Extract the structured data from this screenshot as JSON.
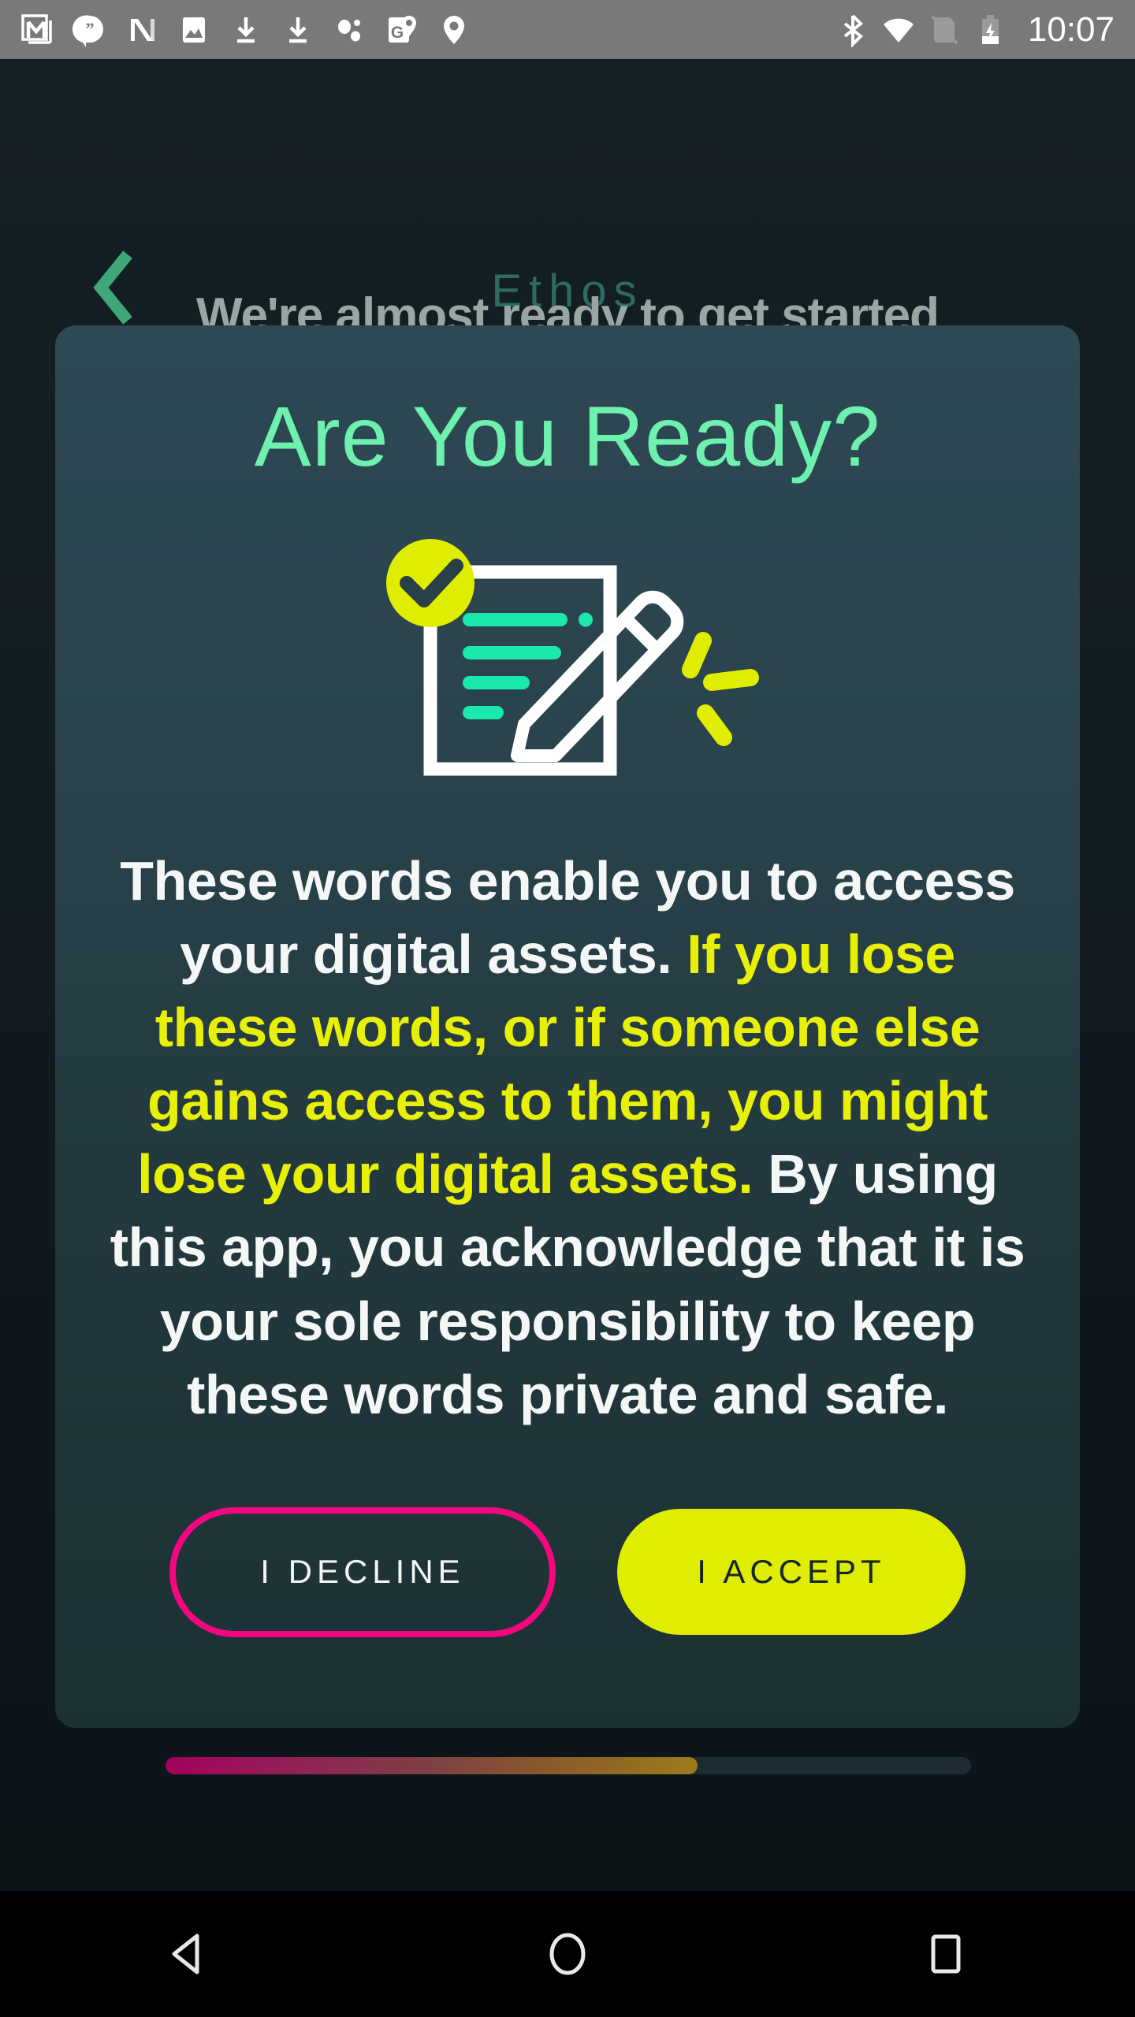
{
  "status_bar": {
    "time": "10:07",
    "left_icons": [
      {
        "name": "gmail-icon",
        "glyph": "M"
      },
      {
        "name": "hangouts-icon",
        "glyph": "❝"
      },
      {
        "name": "news-icon",
        "glyph": "N"
      },
      {
        "name": "photos-icon",
        "glyph": "⛰"
      },
      {
        "name": "download-icon-1",
        "glyph": "⬇"
      },
      {
        "name": "download-icon-2",
        "glyph": "⬇"
      },
      {
        "name": "nearby-share-icon",
        "glyph": "∵"
      },
      {
        "name": "google-maps-pin-icon",
        "glyph": "G"
      },
      {
        "name": "location-pin-icon",
        "glyph": "●"
      }
    ],
    "right_icons": [
      {
        "name": "bluetooth-icon",
        "glyph": "ᛗ"
      },
      {
        "name": "wifi-icon",
        "glyph": "▲"
      },
      {
        "name": "no-sim-icon",
        "glyph": "▭"
      },
      {
        "name": "battery-charging-icon",
        "glyph": "⚡"
      }
    ]
  },
  "top_nav": {
    "back_label": "‹",
    "title": "Ethos"
  },
  "background": {
    "obscured_heading": "We're almost ready to get started"
  },
  "modal": {
    "title": "Are You Ready?",
    "illustration": {
      "name": "signed-document-illustration",
      "check_badge_color": "#DFEE00",
      "check_color": "#2A4048",
      "document_color": "#FFFFFF",
      "line_color": "#1AE8AC",
      "sparkle_color": "#DFEE00",
      "document_lines": 4
    },
    "body": {
      "part1": "These words enable you to access your digital assets. ",
      "highlight": "If you lose these words, or if someone else gains access to them, you might lose your digital assets.",
      "part2": " By using this app, you acknowledge that it is your sole responsibility to keep these words private and safe."
    },
    "decline_label": "I DECLINE",
    "accept_label": "I ACCEPT"
  },
  "progress": {
    "percent": 66,
    "percent_css": "66%",
    "gradient_start": "#A3005C",
    "gradient_end": "#9C7A1B",
    "track_color": "#1D2C33"
  },
  "nav_bar": {
    "back": "back-triangle",
    "home": "home-circle",
    "recents": "recents-square"
  },
  "colors": {
    "accent_mint": "#6EF0AE",
    "accent_yellow": "#DFEE00",
    "accent_pink": "#F4077F",
    "card_top": "#2E4854",
    "card_bottom": "#1B3134",
    "screen_bg": "#0C1418",
    "title_teal": "#2E6A60"
  }
}
